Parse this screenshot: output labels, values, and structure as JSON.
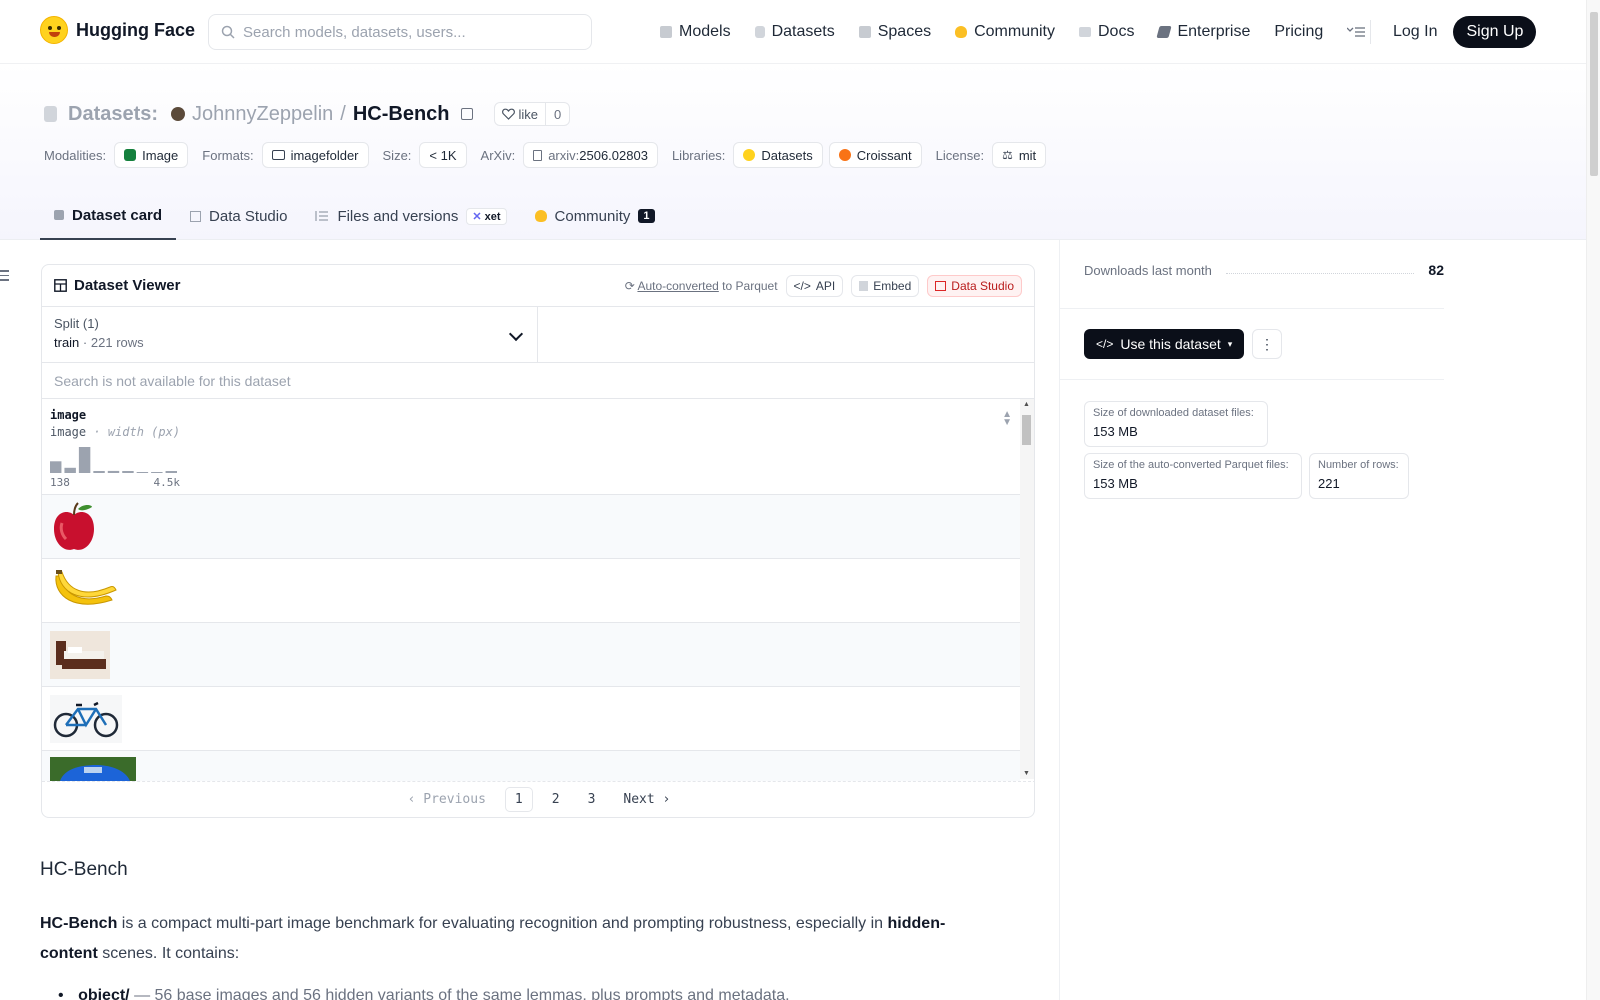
{
  "brand": {
    "name": "Hugging Face"
  },
  "search": {
    "placeholder": "Search models, datasets, users..."
  },
  "nav": {
    "links": [
      {
        "label": "Models",
        "icon": "models-icon",
        "color": "#9ca3af"
      },
      {
        "label": "Datasets",
        "icon": "datasets-icon",
        "color": "#9ca3af"
      },
      {
        "label": "Spaces",
        "icon": "spaces-icon",
        "color": "#9ca3af"
      },
      {
        "label": "Community",
        "icon": "community-icon",
        "color": "#fbbf24"
      },
      {
        "label": "Docs",
        "icon": "docs-icon",
        "color": "#9ca3af"
      },
      {
        "label": "Enterprise",
        "icon": "enterprise-icon",
        "color": "#6b7280"
      },
      {
        "label": "Pricing"
      }
    ],
    "login": "Log In",
    "signup": "Sign Up"
  },
  "repo": {
    "kind": "Datasets:",
    "owner": "JohnnyZeppelin",
    "name": "HC-Bench",
    "like_label": "like",
    "likes": "0"
  },
  "meta": {
    "modalities_label": "Modalities:",
    "modality": "Image",
    "formats_label": "Formats:",
    "format": "imagefolder",
    "size_label": "Size:",
    "size": "< 1K",
    "arxiv_label": "ArXiv:",
    "arxiv_prefix": "arxiv:",
    "arxiv_id": "2506.02803",
    "libraries_label": "Libraries:",
    "libraries": [
      "Datasets",
      "Croissant"
    ],
    "license_label": "License:",
    "license": "mit"
  },
  "tabs": [
    {
      "label": "Dataset card",
      "active": true
    },
    {
      "label": "Data Studio"
    },
    {
      "label": "Files and versions",
      "badge": "xet"
    },
    {
      "label": "Community",
      "count": "1"
    }
  ],
  "viewer": {
    "title": "Dataset Viewer",
    "auto_converted": "Auto-converted",
    "to_parquet": "to Parquet",
    "api": "API",
    "embed": "Embed",
    "data_studio": "Data Studio",
    "split_label": "Split (1)",
    "split_name": "train",
    "split_dot": "·",
    "split_rows": "221 rows",
    "search_na": "Search is not available for this dataset",
    "column": {
      "name": "image",
      "type": "image",
      "type_dot": "·",
      "stat": "width (px)",
      "min_label": "138",
      "max_label": "4.5k",
      "hist": [
        0.45,
        0.2,
        1.0,
        0.05,
        0.08,
        0.05,
        0.0,
        0.0,
        0.04
      ]
    },
    "rows": [
      "apple",
      "banana",
      "bed",
      "bicycle",
      "car"
    ],
    "pager": {
      "prev": "Previous",
      "pages": [
        "1",
        "2",
        "3"
      ],
      "current": "1",
      "next": "Next"
    }
  },
  "sidebar": {
    "downloads_label": "Downloads last month",
    "downloads": "82",
    "use_button": "Use this dataset",
    "stats": [
      {
        "label": "Size of downloaded dataset files:",
        "value": "153 MB"
      },
      {
        "label": "Size of the auto-converted Parquet files:",
        "value": "153 MB"
      },
      {
        "label": "Number of rows:",
        "value": "221"
      }
    ]
  },
  "card": {
    "heading": "HC-Bench",
    "p_strong": "HC-Bench",
    "p_text": "is a compact multi-part image benchmark for evaluating recognition and prompting robustness, especially in",
    "p_strong2": "hidden-content",
    "p_text2": "scenes. It contains:",
    "li_strong": "object/",
    "li_text": "— 56 base images and 56 hidden variants of the same lemmas, plus prompts and metadata."
  },
  "colors": {
    "accent": "#0b0f19",
    "brand_yellow": "#ffd21e",
    "data_studio_red": "#b91c1c"
  }
}
